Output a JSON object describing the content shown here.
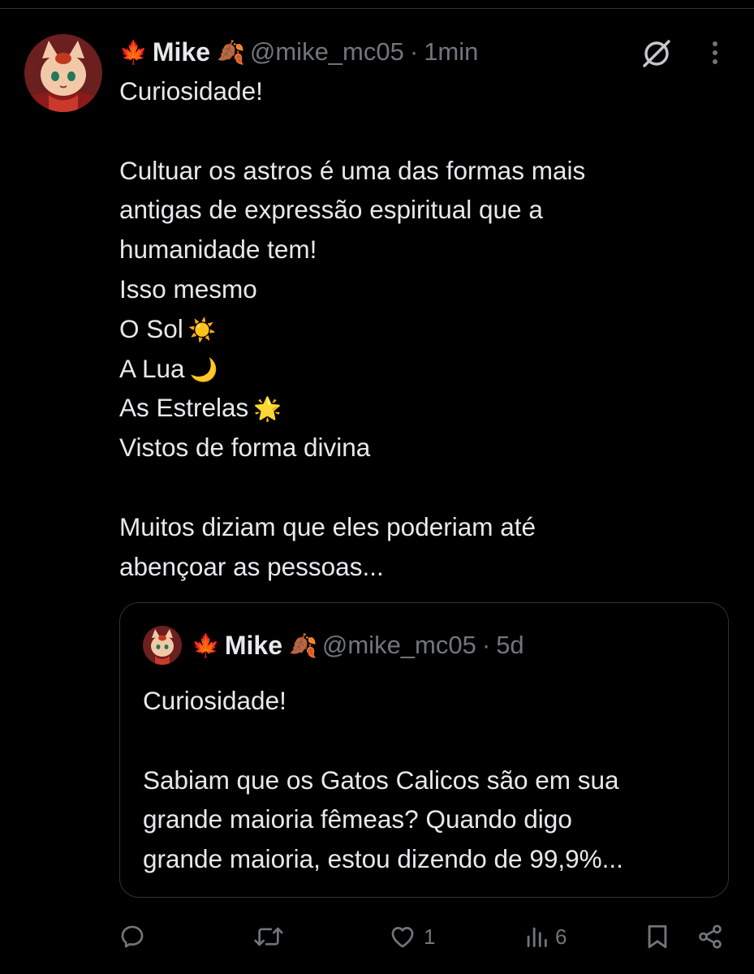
{
  "post": {
    "emoji_before": "🍁",
    "name": "Mike",
    "emoji_after": "🍂",
    "handle": "@mike_mc05",
    "separator": "·",
    "time": "1min",
    "lines": [
      "Curiosidade!",
      "",
      "Cultuar os astros é uma das formas mais",
      "antigas de expressão espiritual que a",
      "humanidade tem!",
      "Isso mesmo",
      "O Sol",
      "A Lua",
      "As Estrelas",
      "Vistos de forma divina",
      "",
      "Muitos diziam que eles poderiam até",
      "abençoar as pessoas..."
    ],
    "sun_emoji": "☀️",
    "moon_emoji": "🌙",
    "star_emoji": "🌟"
  },
  "quoted": {
    "emoji_before": "🍁",
    "name": "Mike",
    "emoji_after": "🍂",
    "handle": "@mike_mc05",
    "separator": "·",
    "time": "5d",
    "lines": [
      "Curiosidade!",
      "",
      "Sabiam que os Gatos Calicos são em sua",
      "grande maioria fêmeas? Quando digo",
      "grande maioria, estou dizendo de 99,9%..."
    ]
  },
  "actions": {
    "reply_icon": "reply-icon",
    "repost_icon": "repost-icon",
    "like_icon": "like-icon",
    "like_count": "1",
    "views_icon": "views-icon",
    "views_count": "6",
    "bookmark_icon": "bookmark-icon",
    "share_icon": "share-icon"
  },
  "colors": {
    "background": "#000000",
    "text": "#e7e9ea",
    "muted": "#71767b",
    "border": "#2f3336"
  }
}
